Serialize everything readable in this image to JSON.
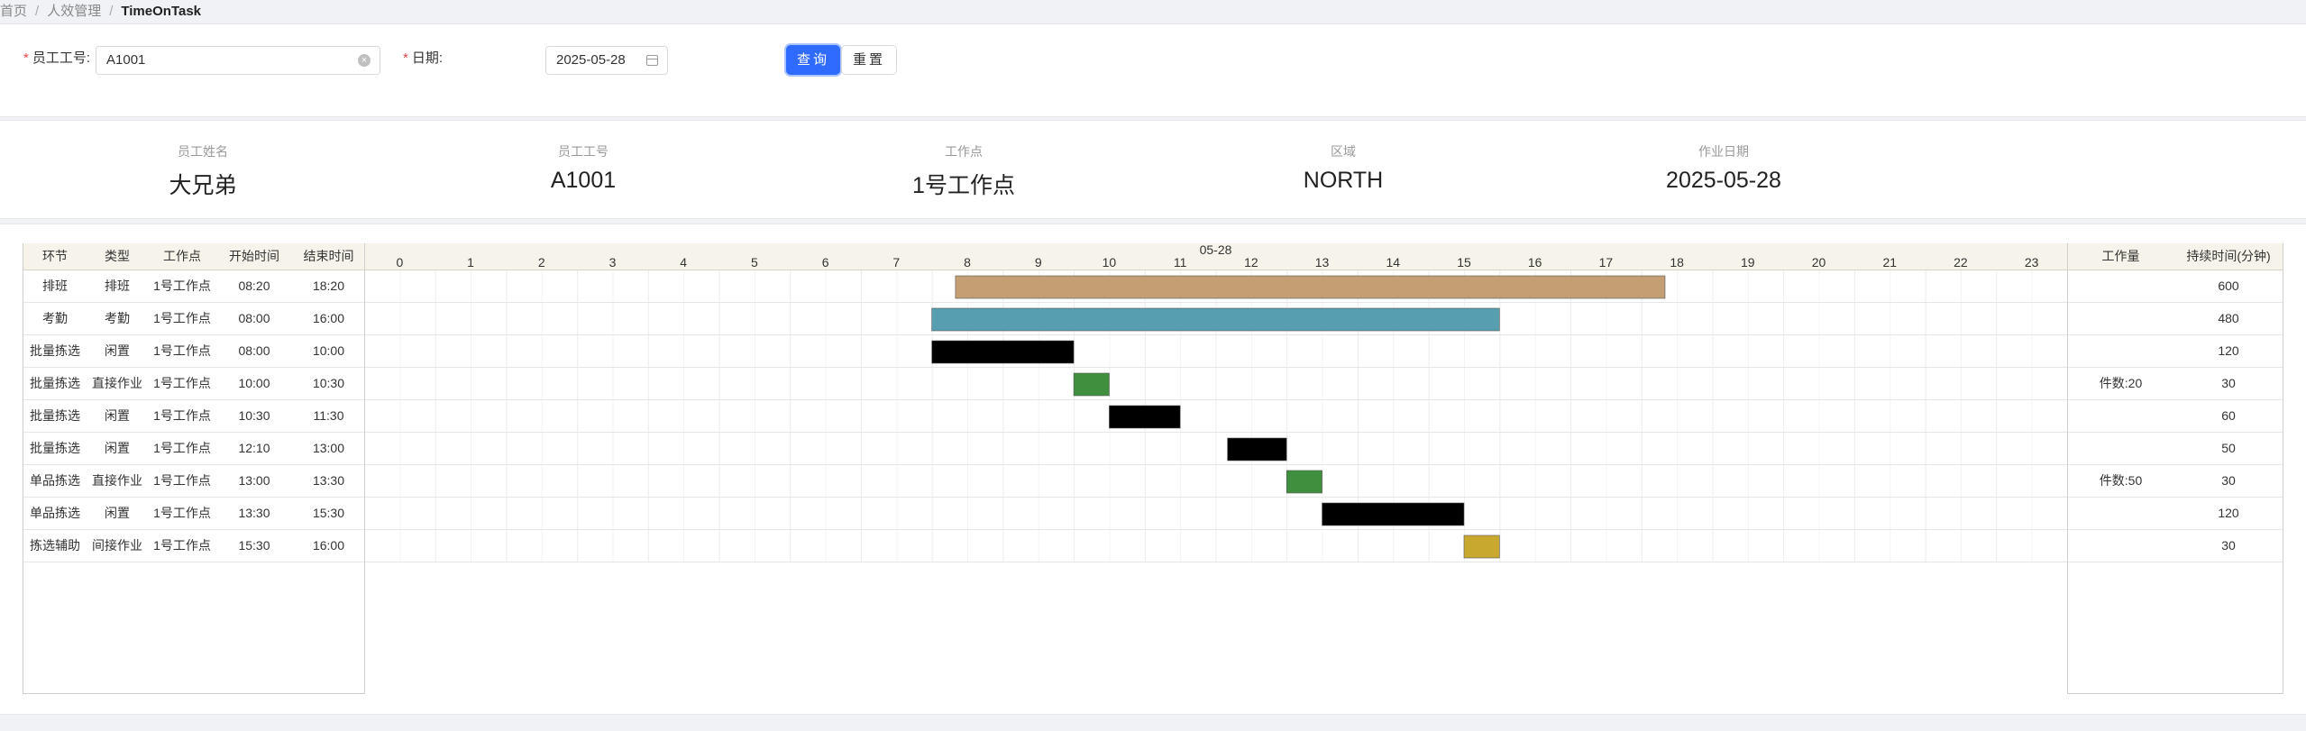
{
  "breadcrumb": {
    "home": "首页",
    "hr": "人效管理",
    "current": "TimeOnTask"
  },
  "search": {
    "employee_label": "员工工号:",
    "employee_value": "A1001",
    "date_label": "日期:",
    "date_value": "2025-05-28",
    "query_button": "查询",
    "reset_button": "重置"
  },
  "info": [
    {
      "label": "员工姓名",
      "value": "大兄弟"
    },
    {
      "label": "员工工号",
      "value": "A1001"
    },
    {
      "label": "工作点",
      "value": "1号工作点"
    },
    {
      "label": "区域",
      "value": "NORTH"
    },
    {
      "label": "作业日期",
      "value": "2025-05-28"
    }
  ],
  "table": {
    "headers": [
      "环节",
      "类型",
      "工作点",
      "开始时间",
      "结束时间"
    ],
    "right_headers": [
      "工作量",
      "持续时间(分钟)"
    ],
    "date_header": "05-28",
    "hours": [
      "0",
      "1",
      "2",
      "3",
      "4",
      "5",
      "6",
      "7",
      "8",
      "9",
      "10",
      "11",
      "12",
      "13",
      "14",
      "15",
      "16",
      "17",
      "18",
      "19",
      "20",
      "21",
      "22",
      "23"
    ],
    "rows": [
      {
        "stage": "排班",
        "type": "排班",
        "site": "1号工作点",
        "start": "08:20",
        "end": "18:20",
        "workload": "",
        "duration": "600",
        "color": "#c49f74"
      },
      {
        "stage": "考勤",
        "type": "考勤",
        "site": "1号工作点",
        "start": "08:00",
        "end": "16:00",
        "workload": "",
        "duration": "480",
        "color": "#579fb0"
      },
      {
        "stage": "批量拣选",
        "type": "闲置",
        "site": "1号工作点",
        "start": "08:00",
        "end": "10:00",
        "workload": "",
        "duration": "120",
        "color": "#000000"
      },
      {
        "stage": "批量拣选",
        "type": "直接作业",
        "site": "1号工作点",
        "start": "10:00",
        "end": "10:30",
        "workload": "件数:20",
        "duration": "30",
        "color": "#3f8f3f"
      },
      {
        "stage": "批量拣选",
        "type": "闲置",
        "site": "1号工作点",
        "start": "10:30",
        "end": "11:30",
        "workload": "",
        "duration": "60",
        "color": "#000000"
      },
      {
        "stage": "批量拣选",
        "type": "闲置",
        "site": "1号工作点",
        "start": "12:10",
        "end": "13:00",
        "workload": "",
        "duration": "50",
        "color": "#000000"
      },
      {
        "stage": "单品拣选",
        "type": "直接作业",
        "site": "1号工作点",
        "start": "13:00",
        "end": "13:30",
        "workload": "件数:50",
        "duration": "30",
        "color": "#3f8f3f"
      },
      {
        "stage": "单品拣选",
        "type": "闲置",
        "site": "1号工作点",
        "start": "13:30",
        "end": "15:30",
        "workload": "",
        "duration": "120",
        "color": "#000000"
      },
      {
        "stage": "拣选辅助",
        "type": "间接作业",
        "site": "1号工作点",
        "start": "15:30",
        "end": "16:00",
        "workload": "",
        "duration": "30",
        "color": "#c9a830"
      }
    ]
  }
}
